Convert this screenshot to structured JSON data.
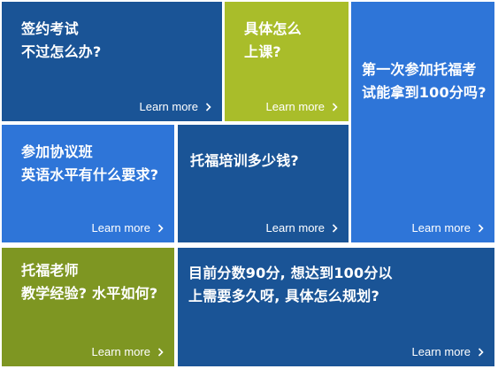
{
  "colors": {
    "dark_blue": "#1a5496",
    "bright_blue": "#2e75d8",
    "lime": "#a9bd2a",
    "olive": "#7e9622"
  },
  "tiles": [
    {
      "title": "签约考试\n不过怎么办?",
      "link": "Learn more",
      "color": "#1a5496",
      "arrow_icon": "chevron-right-icon"
    },
    {
      "title": "具体怎么\n上课?",
      "link": "Learn more",
      "color": "#a9bd2a",
      "arrow_icon": "chevron-right-icon"
    },
    {
      "title": "第一次参加托福考\n试能拿到100分吗?",
      "link": "Learn more",
      "color": "#2e75d8",
      "arrow_icon": "chevron-right-icon"
    },
    {
      "title": "参加协议班\n英语水平有什么要求?",
      "link": "Learn more",
      "color": "#2e75d8",
      "arrow_icon": "chevron-right-icon"
    },
    {
      "title": "托福培训多少钱?",
      "link": "Learn more",
      "color": "#1a5496",
      "arrow_icon": "chevron-right-icon"
    },
    {
      "title": "托福老师\n教学经验? 水平如何?",
      "link": "Learn more",
      "color": "#7e9622",
      "arrow_icon": "chevron-right-icon"
    },
    {
      "title": "目前分数90分, 想达到100分以\n上需要多久呀, 具体怎么规划?",
      "link": "Learn more",
      "color": "#1a5496",
      "arrow_icon": "chevron-right-icon"
    }
  ]
}
